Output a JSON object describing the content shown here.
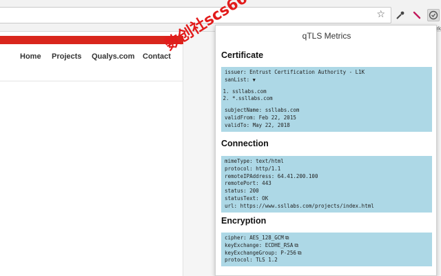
{
  "browser": {
    "bookmarks_snippet": "ark",
    "icons": {
      "star": "star-icon",
      "eyedropper": "eyedropper-icon",
      "wand": "wand-icon",
      "qtls": "qtls-extension-icon"
    }
  },
  "page": {
    "nav": [
      "Home",
      "Projects",
      "Qualys.com",
      "Contact"
    ],
    "colors": {
      "bar": "#d9261c"
    }
  },
  "popup": {
    "title": "qTLS Metrics",
    "certificate": {
      "heading": "Certificate",
      "issuer": "issuer: Entrust Certification Authority - L1K",
      "sanList_label": "sanList:",
      "sanList": [
        "ssllabs.com",
        "*.ssllabs.com"
      ],
      "subjectName": "subjectName: ssllabs.com",
      "validFrom": "validFrom: Feb 22, 2015",
      "validTo": "validTo: May 22, 2018"
    },
    "connection": {
      "heading": "Connection",
      "lines": [
        "mimeType: text/html",
        "protocol: http/1.1",
        "remoteIPAddress: 64.41.200.100",
        "remotePort: 443",
        "status: 200",
        "statusText: OK",
        "url: https://www.ssllabs.com/projects/index.html"
      ]
    },
    "encryption": {
      "heading": "Encryption",
      "cipher": "cipher: AES_128_GCM",
      "keyExchange": "keyExchange: ECDHE_RSA",
      "keyExchangeGroup": "keyExchangeGroup: P-256",
      "protocol": "protocol: TLS 1.2"
    },
    "colors": {
      "box": "#add8e6"
    }
  },
  "watermark": {
    "text": "数创社scs66"
  }
}
